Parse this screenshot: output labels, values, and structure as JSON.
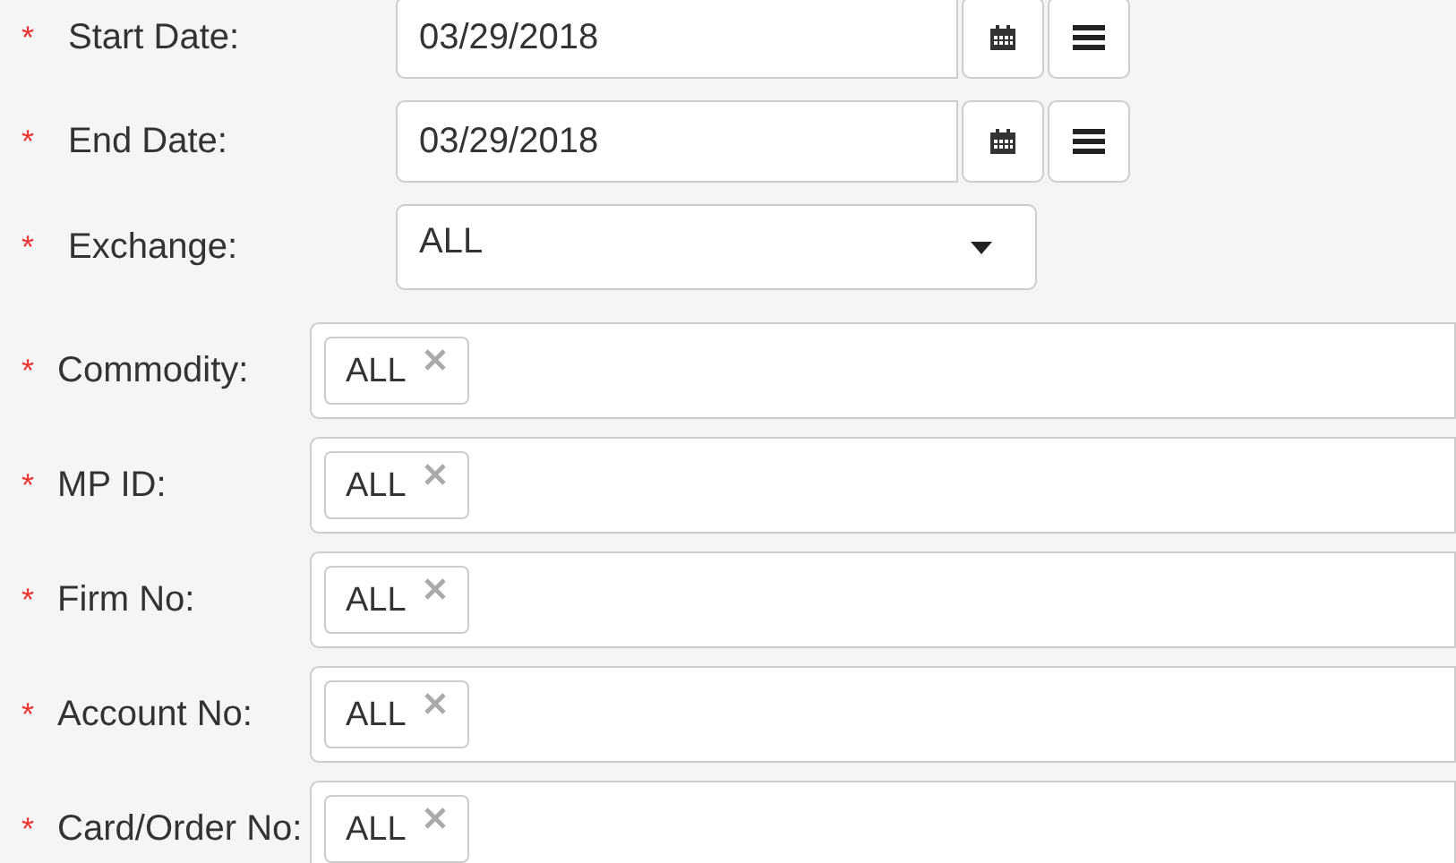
{
  "fields": [
    {
      "kind": "date",
      "mark": "*",
      "label": "Start Date:",
      "value": "03/29/2018"
    },
    {
      "kind": "date",
      "mark": "*",
      "label": "End Date:",
      "value": "03/29/2018"
    },
    {
      "kind": "select",
      "mark": "*",
      "label": "Exchange:",
      "value": "ALL"
    },
    {
      "kind": "tags",
      "mark": "*",
      "label": "Commodity:",
      "tags": [
        "ALL"
      ]
    },
    {
      "kind": "tags",
      "mark": "*",
      "label": "MP ID:",
      "tags": [
        "ALL"
      ]
    },
    {
      "kind": "tags",
      "mark": "*",
      "label": "Firm No:",
      "tags": [
        "ALL"
      ]
    },
    {
      "kind": "tags",
      "mark": "*",
      "label": "Account No:",
      "tags": [
        "ALL"
      ]
    },
    {
      "kind": "tags",
      "mark": "*",
      "label": "Card/Order No:",
      "tags": [
        "ALL"
      ]
    }
  ]
}
